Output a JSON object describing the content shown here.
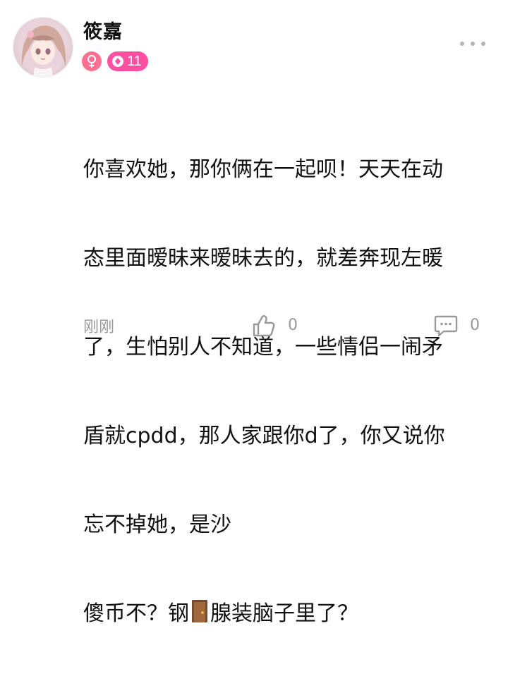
{
  "author": {
    "name": "筱嘉",
    "gender_icon": "female-icon",
    "level_icon": "diamond-icon",
    "level": "11"
  },
  "post": {
    "lines": [
      "你喜欢她，那你俩在一起呗！天天在动",
      "态里面暧昧来暧昧去的，就差奔现左暖",
      "了，生怕别人不知道，一些情侣一闹矛",
      "盾就cpdd，那人家跟你d了，你又说你",
      "忘不掉她，是沙"
    ],
    "last_line_before_emoji": "傻币不？钢",
    "emoji": "door-icon",
    "last_line_after_emoji": "腺装脑子里了？"
  },
  "footer": {
    "time": "刚刚",
    "like_count": "0",
    "comment_count": "0"
  },
  "colors": {
    "gender_badge": "#ff6f92",
    "level_badge": "#ff4fa2",
    "muted_text": "#999999"
  }
}
